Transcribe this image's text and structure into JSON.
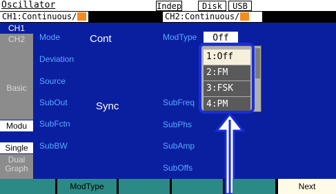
{
  "header": {
    "title": "Oscillator",
    "mode_indicator": "Indep",
    "buttons": [
      "Disk",
      "USB"
    ]
  },
  "channels": {
    "ch1_status": "CH1:Continuous/",
    "ch2_status": "CH2:Continuous/",
    "status_mark_color": "#f58a1f"
  },
  "tabs": {
    "ch1": "CH1",
    "ch2": "CH2",
    "basic": "Basic",
    "modu": "Modu",
    "single": "Single",
    "dual": "Dual",
    "graph": "Graph"
  },
  "left_params": {
    "mode": {
      "label": "Mode",
      "value": "Cont"
    },
    "deviation": "Deviation",
    "source": "Source",
    "subout": {
      "label": "SubOut",
      "value": "Sync"
    },
    "subfctn": "SubFctn",
    "subbw": "SubBW"
  },
  "right_params": {
    "modtype": {
      "label": "ModType",
      "value": "Off"
    },
    "subfreq": "SubFreq",
    "subphs": "SubPhs",
    "subamp": "SubAmp",
    "suboffs": "SubOffs"
  },
  "dropdown": {
    "options": [
      "1:Off",
      "2:FM",
      "3:FSK",
      "4:PM"
    ],
    "selected_index": 0,
    "highlight_color": "#1a2ed8"
  },
  "function_keys": [
    "",
    "ModType",
    "",
    "",
    "",
    "Next"
  ],
  "colors": {
    "main_bg": "#0a1fa0",
    "param_label": "#5aa8ff",
    "function_key": "#2b8a86"
  }
}
